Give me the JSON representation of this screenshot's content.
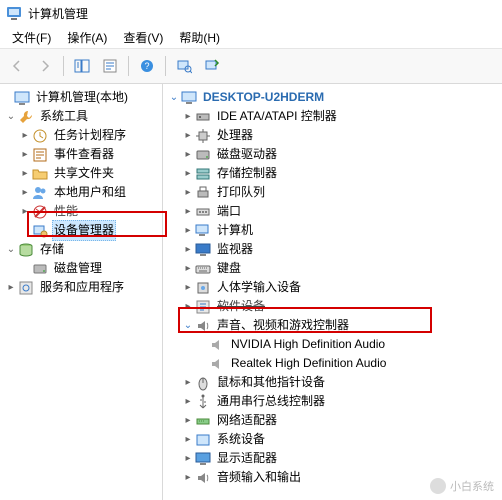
{
  "window": {
    "title": "计算机管理"
  },
  "menu": {
    "file": "文件(F)",
    "action": "操作(A)",
    "view": "查看(V)",
    "help": "帮助(H)"
  },
  "left_tree": {
    "root": "计算机管理(本地)",
    "system_tools": "系统工具",
    "task_scheduler": "任务计划程序",
    "event_viewer": "事件查看器",
    "shared_folders": "共享文件夹",
    "local_users": "本地用户和组",
    "performance": "性能",
    "device_manager": "设备管理器",
    "storage": "存储",
    "disk_mgmt": "磁盘管理",
    "services_apps": "服务和应用程序"
  },
  "right_tree": {
    "computer": "DESKTOP-U2HDERM",
    "ide": "IDE ATA/ATAPI 控制器",
    "cpu": "处理器",
    "disk_drives": "磁盘驱动器",
    "storage_ctrl": "存储控制器",
    "print_queue": "打印队列",
    "ports": "端口",
    "computers": "计算机",
    "monitors": "监视器",
    "keyboards": "键盘",
    "hid": "人体学输入设备",
    "software_dev": "软件设备",
    "sound": "声音、视频和游戏控制器",
    "sound_child1": "NVIDIA High Definition Audio",
    "sound_child2": "Realtek High Definition Audio",
    "mouse": "鼠标和其他指针设备",
    "usb": "通用串行总线控制器",
    "network": "网络适配器",
    "system_dev": "系统设备",
    "display": "显示适配器",
    "audio_io": "音频输入和输出"
  },
  "watermark": "小白系统"
}
